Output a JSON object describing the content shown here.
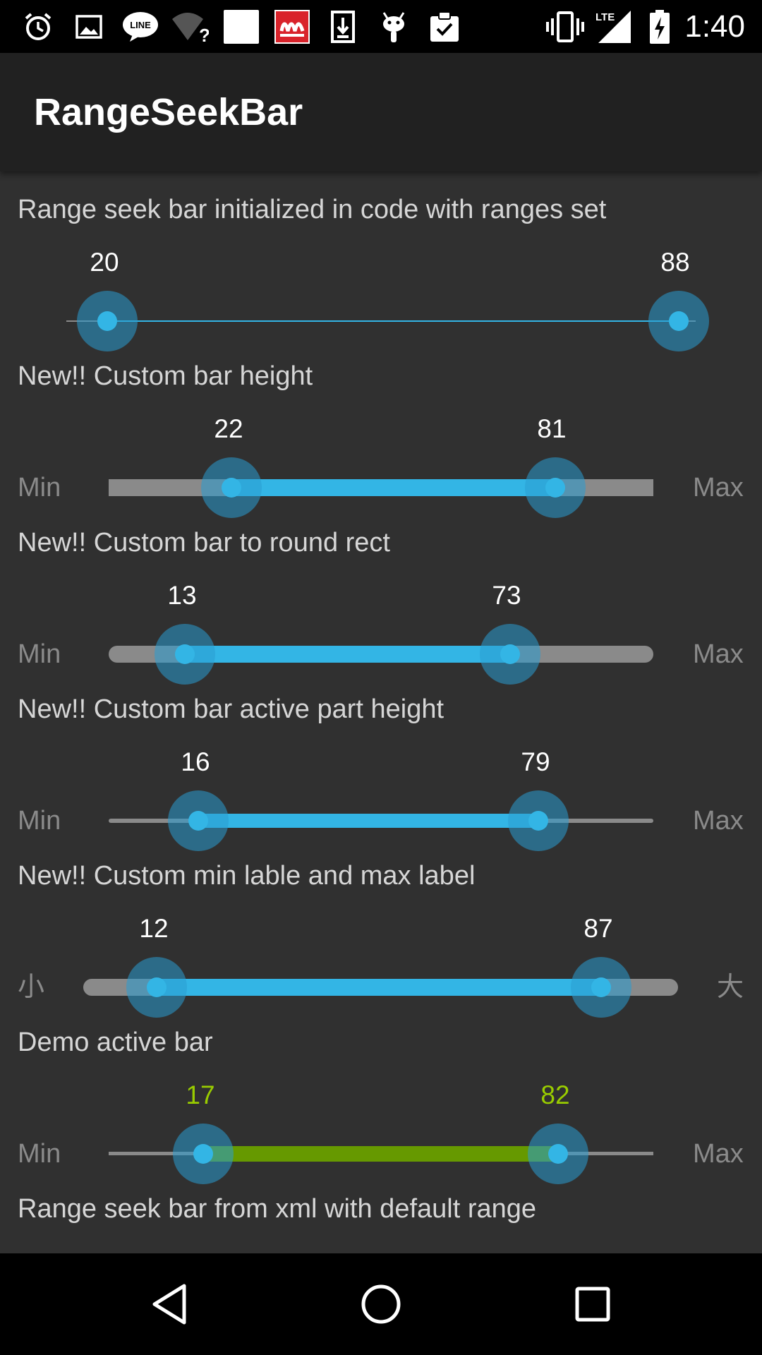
{
  "status_bar": {
    "time": "1:40",
    "network": "LTE",
    "left_icons": [
      "alarm-icon",
      "gallery-icon",
      "line-app-icon",
      "wifi-unknown-icon",
      "blank-notification-icon",
      "mos-burger-icon",
      "download-icon",
      "android-icon",
      "clipboard-check-icon"
    ],
    "right_icons": [
      "vibrate-icon",
      "signal-lte-icon",
      "battery-charging-icon"
    ]
  },
  "app_bar": {
    "title": "RangeSeekBar"
  },
  "sections": [
    {
      "label": "Range seek bar initialized in code with ranges set",
      "min_value": "20",
      "max_value": "88",
      "style": "thin-line",
      "min_label": "",
      "max_label": ""
    },
    {
      "label": "New!! Custom bar height",
      "min_value": "22",
      "max_value": "81",
      "style": "thick-rect",
      "min_label": "Min",
      "max_label": "Max"
    },
    {
      "label": "New!! Custom bar to round rect",
      "min_value": "13",
      "max_value": "73",
      "style": "round-rect",
      "min_label": "Min",
      "max_label": "Max"
    },
    {
      "label": "New!! Custom bar active part height",
      "min_value": "16",
      "max_value": "79",
      "style": "active-height",
      "min_label": "Min",
      "max_label": "Max"
    },
    {
      "label": "New!! Custom min lable and max label",
      "min_value": "12",
      "max_value": "87",
      "style": "round-rect",
      "min_label": "小",
      "max_label": "大"
    },
    {
      "label": "Demo active bar",
      "min_value": "17",
      "max_value": "82",
      "style": "active-color",
      "min_label": "Min",
      "max_label": "Max"
    }
  ],
  "footer_label": "Range seek bar from xml with default range",
  "colors": {
    "accent": "#33b5e5",
    "active_demo_bar": "#669900",
    "active_demo_text": "#99cc00",
    "track": "#8a8a8a",
    "background": "#303030",
    "app_bar": "#212121"
  },
  "nav_bar": {
    "icons": [
      "back-icon",
      "home-icon",
      "recents-icon"
    ]
  }
}
